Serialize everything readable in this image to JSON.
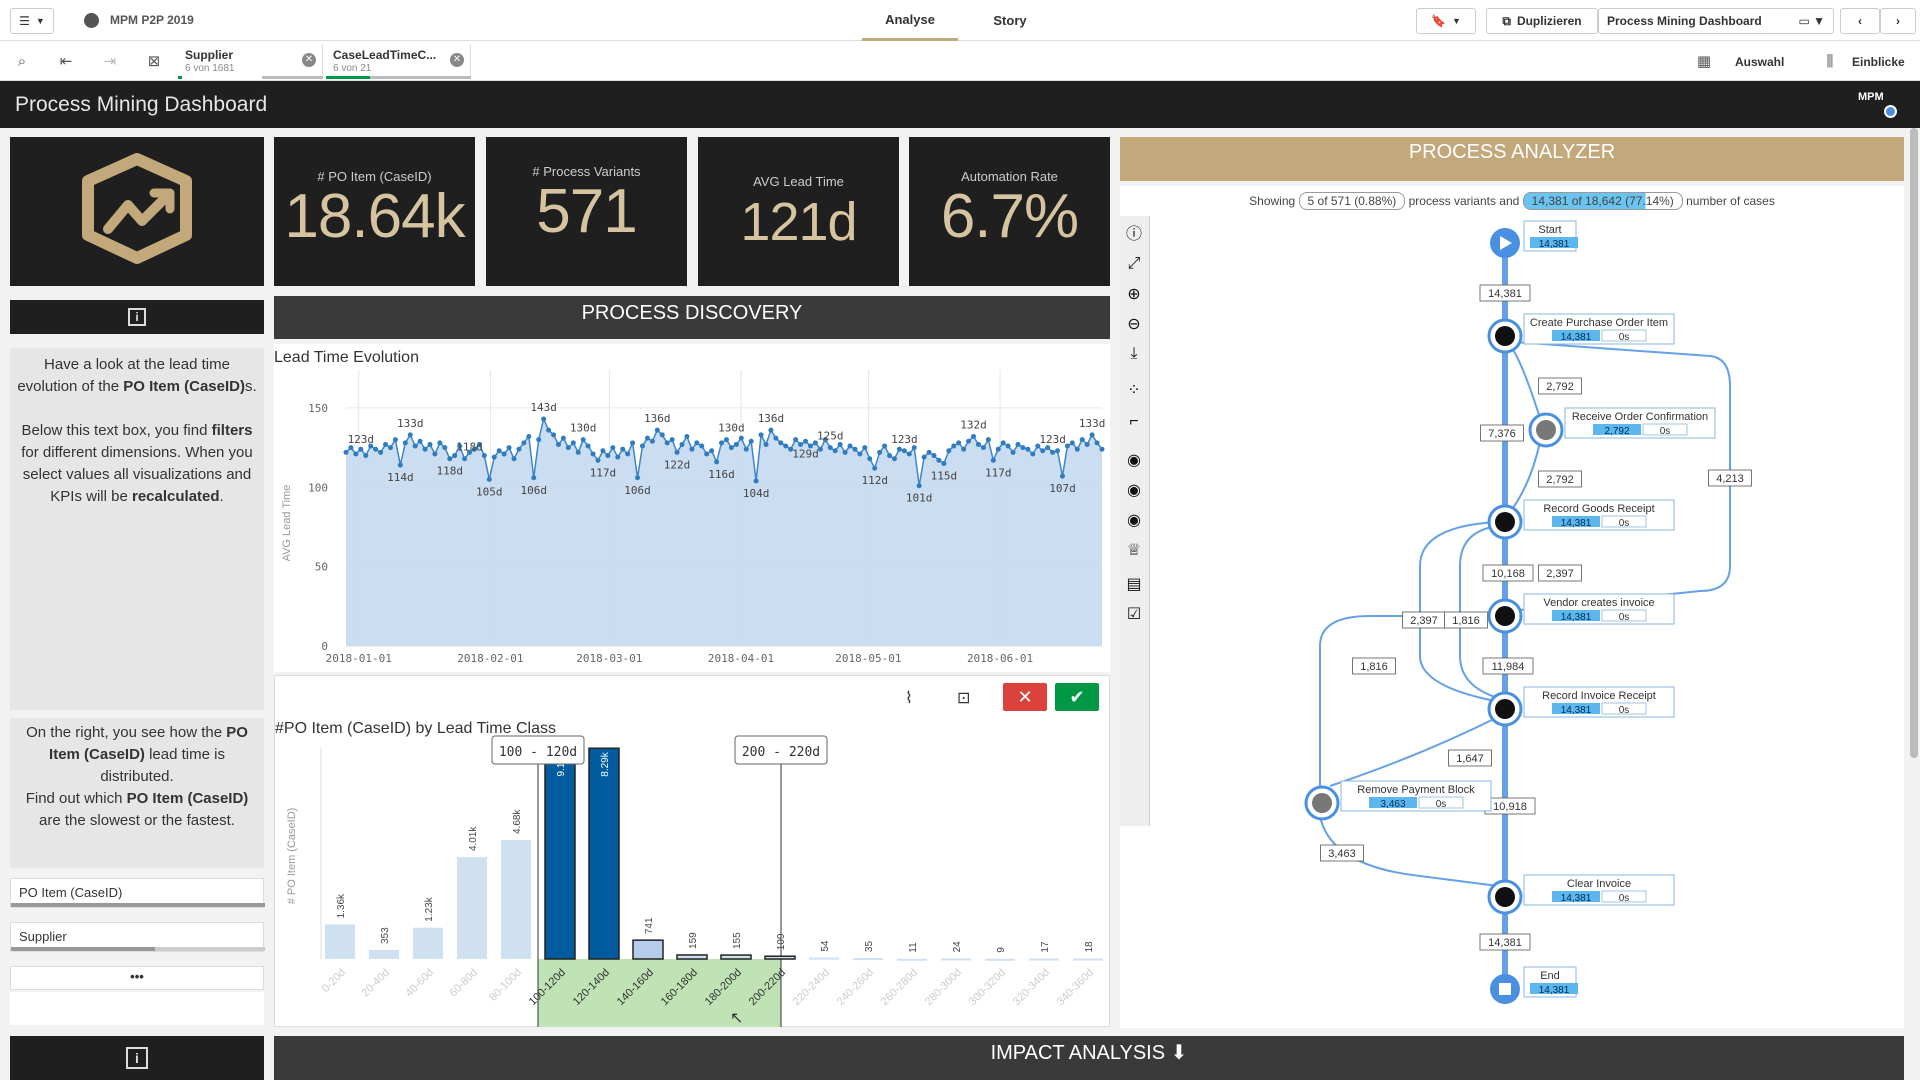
{
  "topbar": {
    "app_title": "MPM P2P 2019",
    "tabs": [
      "Analyse",
      "Story"
    ],
    "duplicate_label": "Duplizieren",
    "sheet_name": "Process Mining Dashboard"
  },
  "selections": {
    "chips": [
      {
        "name": "Supplier",
        "count": "6 von 1681"
      },
      {
        "name": "CaseLeadTimeC...",
        "count": "6 von 21"
      }
    ],
    "auswahl_label": "Auswahl",
    "einblicke_label": "Einblicke"
  },
  "dashboard_title": "Process Mining Dashboard",
  "logo_text": "MPM",
  "kpis": [
    {
      "label": "# PO Item (CaseID)",
      "value": "18.64k"
    },
    {
      "label": "# Process Variants",
      "value": "571"
    },
    {
      "label": "AVG Lead Time",
      "value": "121d"
    },
    {
      "label": "Automation Rate",
      "value": "6.7%"
    }
  ],
  "info_glyph": "i",
  "text1": {
    "p1_a": "Have a look at the lead time evolution of the ",
    "p1_b": "PO Item (CaseID)",
    "p1_c": "s.",
    "p2_a": "Below this text box, you find ",
    "p2_b": "filters",
    "p2_c": " for different dimensions. When you select values all visualizations and KPIs will be ",
    "p2_d": "recalculated",
    "p2_e": "."
  },
  "text2": {
    "a": "On the right, you see how the ",
    "b": "PO Item (CaseID)",
    "c": " lead time is distributed.",
    "d": "Find out which ",
    "e": "PO Item (CaseID)",
    "f": " are the slowest or the fastest."
  },
  "filters": [
    "PO Item (CaseID)",
    "Supplier"
  ],
  "more_label": "•••",
  "process_discovery_title": "PROCESS DISCOVERY",
  "process_analyzer_title": "PROCESS ANALYZER",
  "impact_analysis_title": "IMPACT ANALYSIS ⬇",
  "analyzer": {
    "showing": "Showing",
    "variants_badge": "5 of 571 (0.88%)",
    "mid": "process variants and",
    "cases_badge": "14,381 of 18,642 (77.14%)",
    "end": "number of cases"
  },
  "process_nodes": [
    {
      "name": "Start",
      "count": "14,381",
      "dur": ""
    },
    {
      "name": "Create Purchase Order Item",
      "count": "14,381",
      "dur": "0s"
    },
    {
      "name": "Receive Order Confirmation",
      "count": "2,792",
      "dur": "0s"
    },
    {
      "name": "Record Goods Receipt",
      "count": "14,381",
      "dur": "0s"
    },
    {
      "name": "Vendor creates invoice",
      "count": "14,381",
      "dur": "0s"
    },
    {
      "name": "Record Invoice Receipt",
      "count": "14,381",
      "dur": "0s"
    },
    {
      "name": "Remove Payment Block",
      "count": "3,463",
      "dur": "0s"
    },
    {
      "name": "Clear Invoice",
      "count": "14,381",
      "dur": "0s"
    },
    {
      "name": "End",
      "count": "14,381",
      "dur": ""
    }
  ],
  "edge_labels": [
    "14,381",
    "2,792",
    "7,376",
    "2,792",
    "4,213",
    "10,168",
    "2,397",
    "2,397",
    "1,816",
    "11,984",
    "1,816",
    "1,647",
    "10,918",
    "3,463",
    "14,381"
  ],
  "chart_data": [
    {
      "type": "area",
      "title": "Lead Time Evolution",
      "ylabel": "AVG Lead Time",
      "ylim": [
        0,
        155
      ],
      "yticks": [
        0,
        50,
        100,
        150
      ],
      "xticks": [
        "2018-01-01",
        "2018-02-01",
        "2018-03-01",
        "2018-04-01",
        "2018-05-01",
        "2018-06-01"
      ],
      "x_range": [
        "2017-12-29",
        "2018-06-25"
      ],
      "labels": [
        {
          "t": "123d",
          "x": 3,
          "v": 123,
          "pos": "above"
        },
        {
          "t": "133d",
          "x": 13,
          "v": 133,
          "pos": "above"
        },
        {
          "t": "114d",
          "x": 11,
          "v": 114,
          "pos": "below"
        },
        {
          "t": "118d",
          "x": 25,
          "v": 118,
          "pos": "above"
        },
        {
          "t": "118d",
          "x": 21,
          "v": 118,
          "pos": "below"
        },
        {
          "t": "105d",
          "x": 29,
          "v": 105,
          "pos": "below"
        },
        {
          "t": "143d",
          "x": 40,
          "v": 143,
          "pos": "above"
        },
        {
          "t": "106d",
          "x": 38,
          "v": 106,
          "pos": "below"
        },
        {
          "t": "130d",
          "x": 48,
          "v": 130,
          "pos": "above"
        },
        {
          "t": "117d",
          "x": 52,
          "v": 117,
          "pos": "below"
        },
        {
          "t": "136d",
          "x": 63,
          "v": 136,
          "pos": "above"
        },
        {
          "t": "106d",
          "x": 59,
          "v": 106,
          "pos": "below"
        },
        {
          "t": "122d",
          "x": 67,
          "v": 122,
          "pos": "below"
        },
        {
          "t": "130d",
          "x": 78,
          "v": 130,
          "pos": "above"
        },
        {
          "t": "116d",
          "x": 76,
          "v": 116,
          "pos": "below"
        },
        {
          "t": "136d",
          "x": 86,
          "v": 136,
          "pos": "above"
        },
        {
          "t": "104d",
          "x": 83,
          "v": 104,
          "pos": "below"
        },
        {
          "t": "129d",
          "x": 93,
          "v": 129,
          "pos": "below"
        },
        {
          "t": "125d",
          "x": 98,
          "v": 125,
          "pos": "above"
        },
        {
          "t": "112d",
          "x": 107,
          "v": 112,
          "pos": "below"
        },
        {
          "t": "123d",
          "x": 113,
          "v": 123,
          "pos": "above"
        },
        {
          "t": "101d",
          "x": 116,
          "v": 101,
          "pos": "below"
        },
        {
          "t": "115d",
          "x": 121,
          "v": 115,
          "pos": "below"
        },
        {
          "t": "132d",
          "x": 127,
          "v": 132,
          "pos": "above"
        },
        {
          "t": "117d",
          "x": 132,
          "v": 117,
          "pos": "below"
        },
        {
          "t": "123d",
          "x": 143,
          "v": 123,
          "pos": "above"
        },
        {
          "t": "107d",
          "x": 145,
          "v": 107,
          "pos": "below"
        },
        {
          "t": "133d",
          "x": 151,
          "v": 133,
          "pos": "above"
        }
      ],
      "values": [
        122,
        125,
        121,
        124,
        120,
        126,
        124,
        122,
        127,
        125,
        130,
        114,
        128,
        133,
        126,
        129,
        124,
        127,
        121,
        128,
        125,
        118,
        120,
        126,
        118,
        122,
        124,
        127,
        120,
        105,
        119,
        123,
        121,
        125,
        118,
        124,
        128,
        132,
        106,
        130,
        143,
        136,
        133,
        127,
        131,
        125,
        128,
        122,
        130,
        126,
        121,
        117,
        123,
        120,
        125,
        119,
        124,
        121,
        128,
        106,
        126,
        131,
        129,
        136,
        133,
        128,
        130,
        122,
        127,
        132,
        124,
        128,
        126,
        121,
        123,
        116,
        128,
        130,
        125,
        127,
        131,
        124,
        129,
        104,
        133,
        127,
        136,
        131,
        128,
        126,
        124,
        130,
        127,
        129,
        126,
        128,
        124,
        130,
        125,
        123,
        127,
        122,
        126,
        124,
        121,
        125,
        118,
        112,
        122,
        126,
        120,
        118,
        124,
        123,
        121,
        125,
        101,
        119,
        122,
        120,
        117,
        115,
        123,
        126,
        128,
        124,
        129,
        132,
        127,
        125,
        130,
        117,
        124,
        128,
        126,
        122,
        127,
        125,
        124,
        121,
        126,
        123,
        125,
        122,
        123,
        107,
        126,
        128,
        124,
        130,
        127,
        133,
        128,
        124
      ]
    },
    {
      "type": "bar",
      "title": "#PO Item (CaseID) by Lead Time Class",
      "ylabel": "# PO Item (CaseID)",
      "categories": [
        "0-20d",
        "20-40d",
        "40-60d",
        "60-80d",
        "80-100d",
        "100-120d",
        "120-140d",
        "140-160d",
        "160-180d",
        "180-200d",
        "200-220d",
        "220-240d",
        "240-260d",
        "260-280d",
        "280-300d",
        "300-320d",
        "320-340d",
        "340-360d"
      ],
      "values": [
        1360,
        353,
        1230,
        4010,
        4680,
        9160,
        8290,
        741,
        159,
        155,
        109,
        54,
        35,
        11,
        24,
        9,
        17,
        18
      ],
      "value_labels": [
        "1.36k",
        "353",
        "1.23k",
        "4.01k",
        "4.68k",
        "9.16k",
        "8.29k",
        "741",
        "159",
        "155",
        "109",
        "54",
        "35",
        "11",
        "24",
        "9",
        "17",
        "18"
      ],
      "selected": [
        5,
        6
      ],
      "selection_range": [
        "100 - 120d",
        "200 - 220d"
      ],
      "ylim": [
        0,
        8300
      ]
    }
  ],
  "colors": {
    "gold": "#c2a87a",
    "dark": "#1f1f1f",
    "flow_blue": "#4a90e2",
    "bar_selected": "#005c9e",
    "bar_light": "#cfe0f1"
  }
}
